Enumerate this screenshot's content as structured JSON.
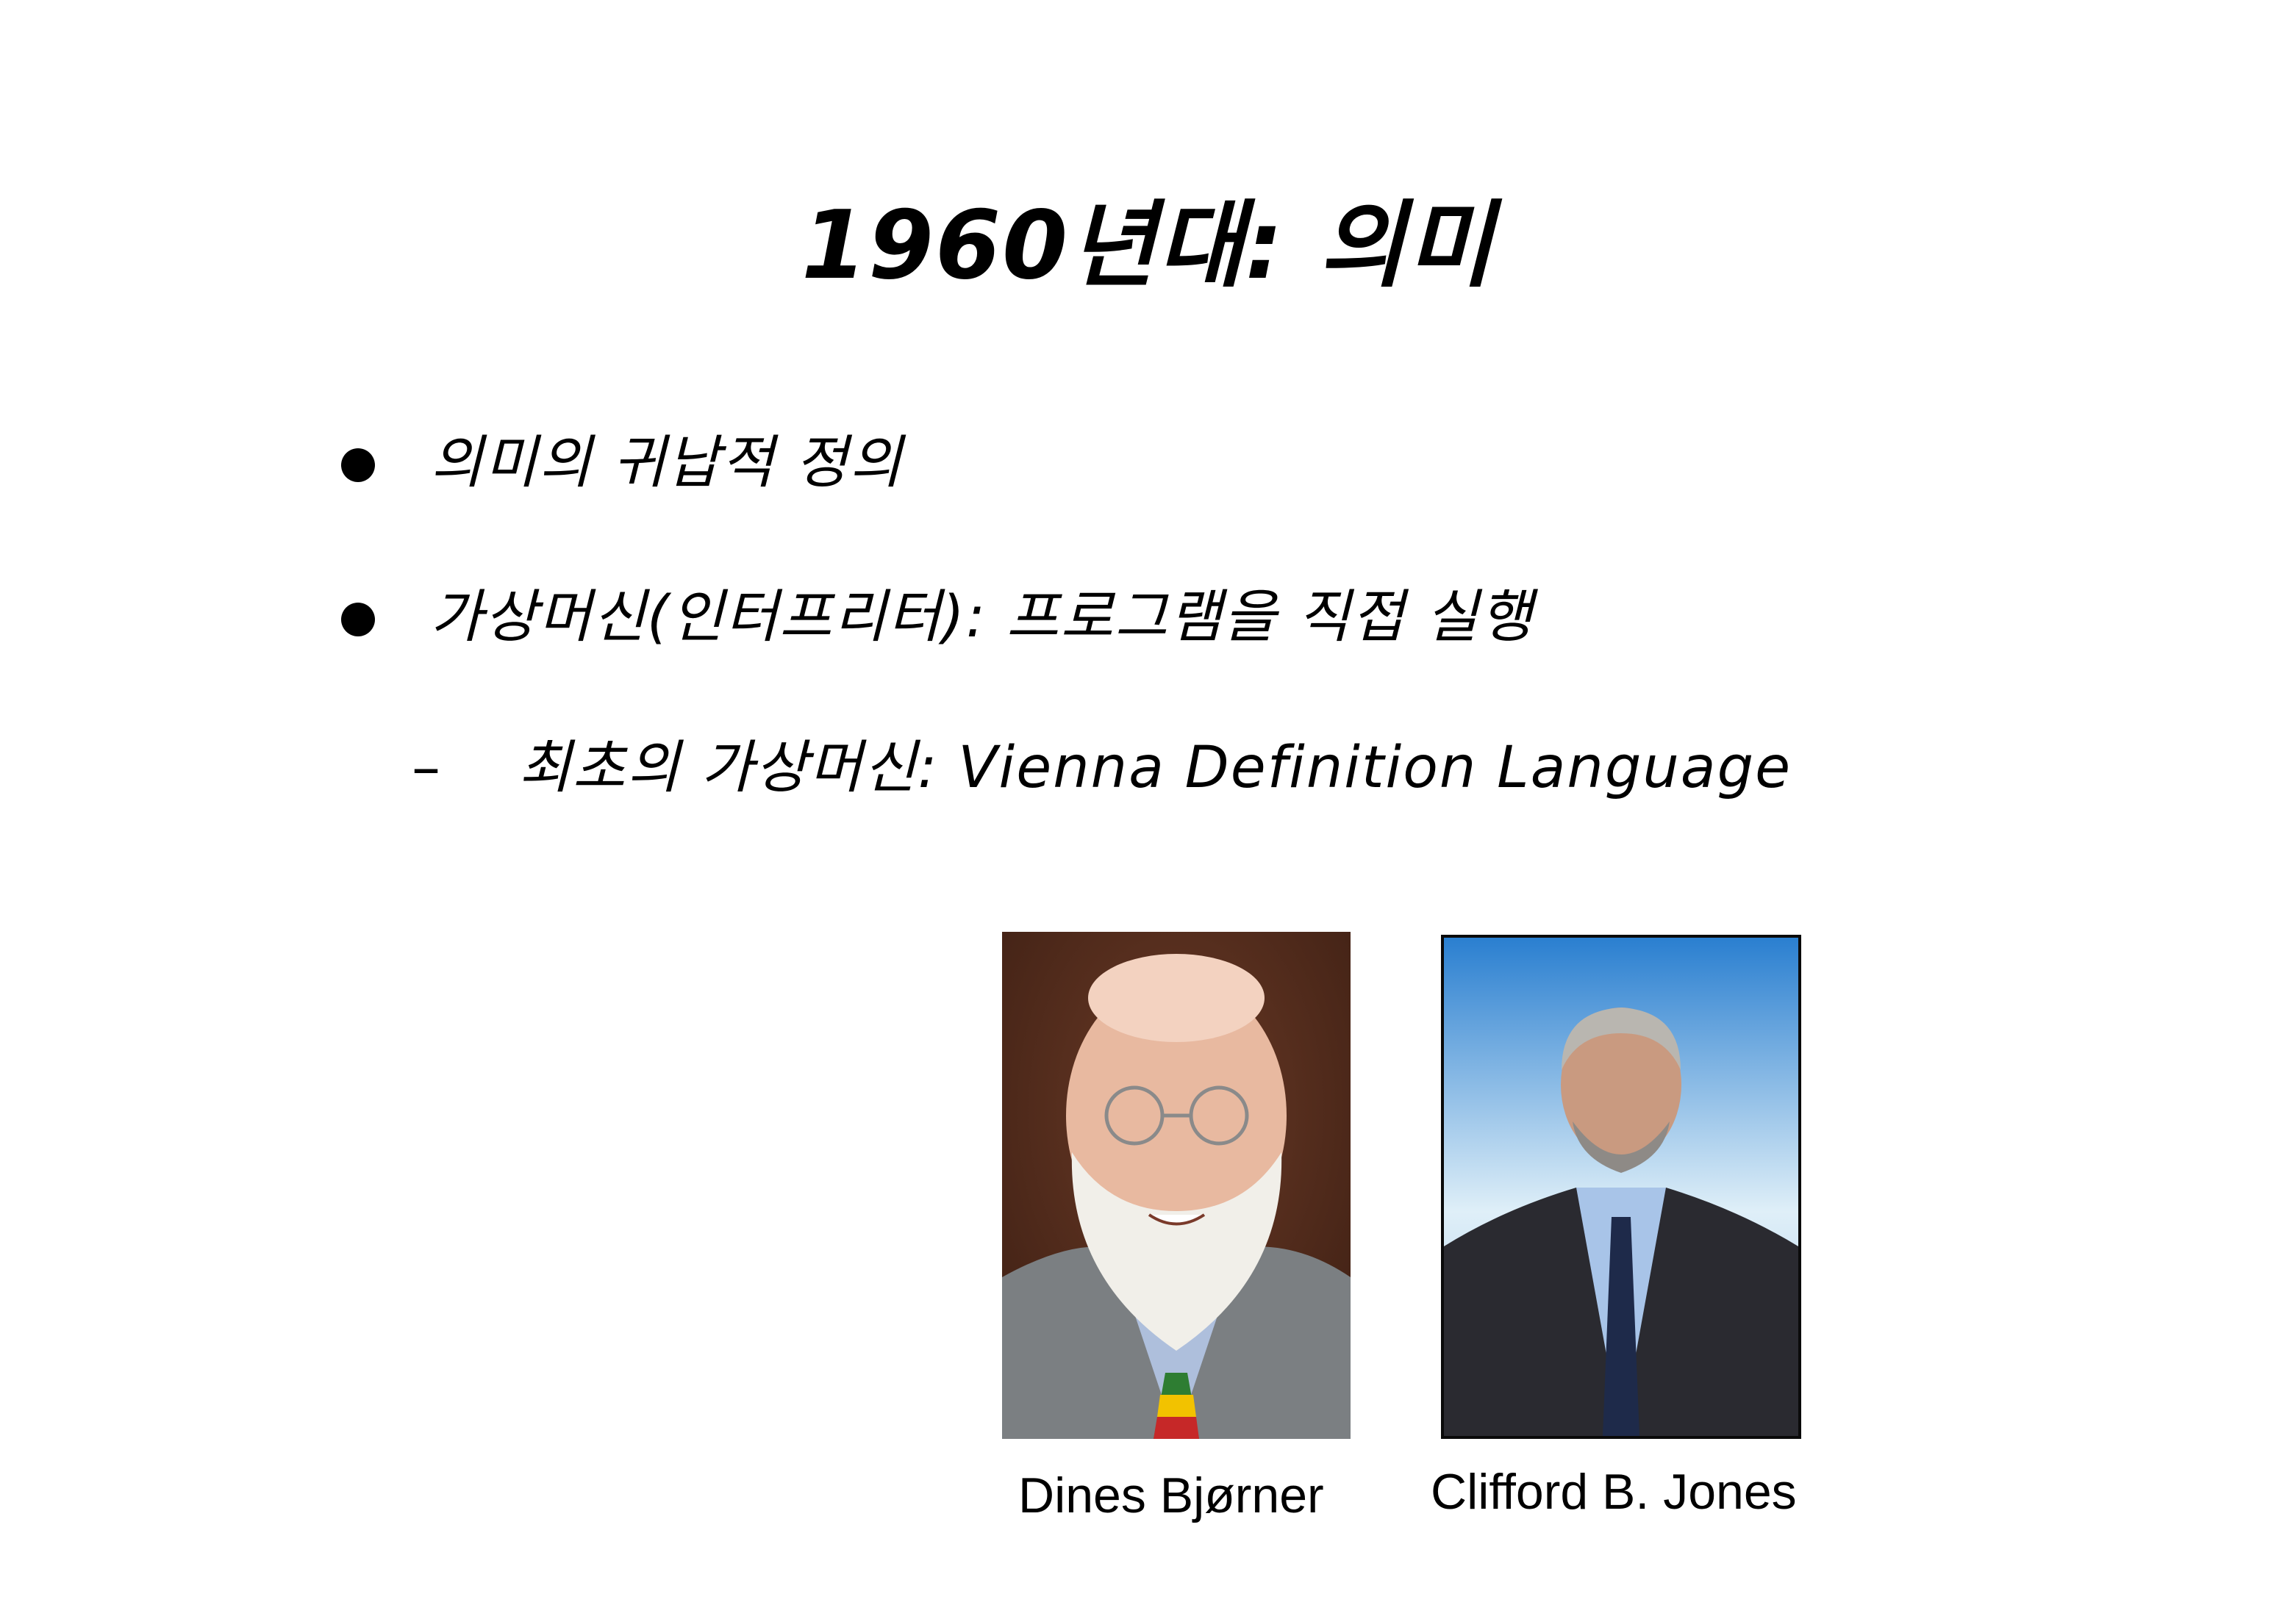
{
  "slide": {
    "title": "1960년대: 의미",
    "bullets": [
      {
        "text": "의미의 귀납적 정의"
      },
      {
        "text": "가상머신(인터프리터): 프로그램을 직접 실행"
      }
    ],
    "sub_bullet": {
      "dash": "–",
      "text": "최초의 가상머신: Vienna Definition Language"
    },
    "photos": [
      {
        "caption": "Dines Bjørner",
        "background": "#5a2f1f"
      },
      {
        "caption": "Clifford B. Jones",
        "background": "#4a98d8"
      }
    ]
  }
}
